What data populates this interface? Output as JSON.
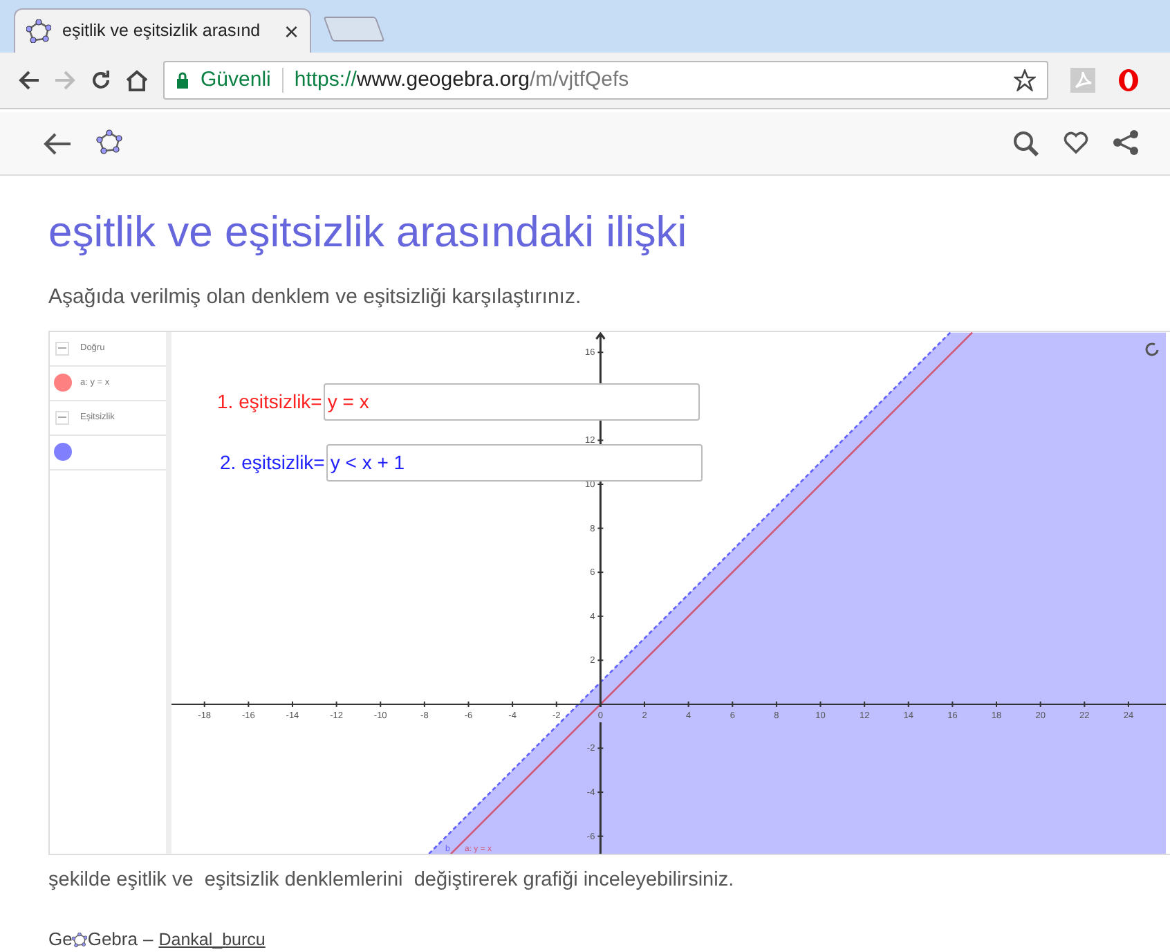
{
  "browser": {
    "tab": {
      "title": "eşitlik ve eşitsizlik arasınd",
      "close": "×"
    },
    "toolbar": {
      "forward_disabled": true
    },
    "address": {
      "security": "Güvenli",
      "url_scheme": "https://",
      "url_host": "www.geogebra.org",
      "url_path": "/m/vjtfQefs"
    }
  },
  "page": {
    "title": "eşitlik ve eşitsizlik arasındaki ilişki",
    "intro": "Aşağıda verilmiş olan denklem ve eşitsizliği karşılaştırınız.",
    "caption": "şekilde eşitlik ve  eşitsizlik denklemlerini  değiştirerek grafiği inceleyebilirsiniz."
  },
  "applet": {
    "algebra": [
      {
        "kind": "header",
        "label": "Doğru"
      },
      {
        "kind": "object",
        "label": "a: y = x",
        "color": "#ff8080"
      },
      {
        "kind": "header",
        "label": "Eşitsizlik"
      },
      {
        "kind": "object",
        "color": "#8080ff"
      }
    ],
    "inputs": [
      {
        "label": "1. eşitsizlik=",
        "value": "y = x",
        "color": "#ff2020"
      },
      {
        "label": "2. eşitsizlik=",
        "value": "y < x + 1",
        "color": "#2020ff"
      }
    ],
    "chart_data": {
      "type": "line",
      "x": [
        -7.8,
        -6.8,
        15.9,
        16.9
      ],
      "xlim": [
        -19.5,
        25.7
      ],
      "ylim": [
        -6.86,
        16.92
      ],
      "xticks": [
        -18,
        -16,
        -14,
        -12,
        -10,
        -8,
        -6,
        -4,
        -2,
        0,
        2,
        4,
        6,
        8,
        10,
        12,
        14,
        16,
        18,
        20,
        22,
        24
      ],
      "yticks": [
        16,
        12,
        10,
        8,
        6,
        4,
        2,
        -2,
        -4,
        -6
      ],
      "series": [
        {
          "name": "b",
          "color": "#6060ff",
          "values": [
            -6.8,
            -5.8,
            16.9,
            null
          ],
          "line_style": "dashed"
        },
        {
          "name": "a: y = x",
          "color": "#d05878",
          "values": [
            null,
            -6.8,
            15.9,
            16.9
          ]
        }
      ]
    }
  },
  "footer": {
    "logo_left": "Ge",
    "logo_right": "Gebra",
    "separator": "–",
    "author": "Dankal_burcu"
  }
}
